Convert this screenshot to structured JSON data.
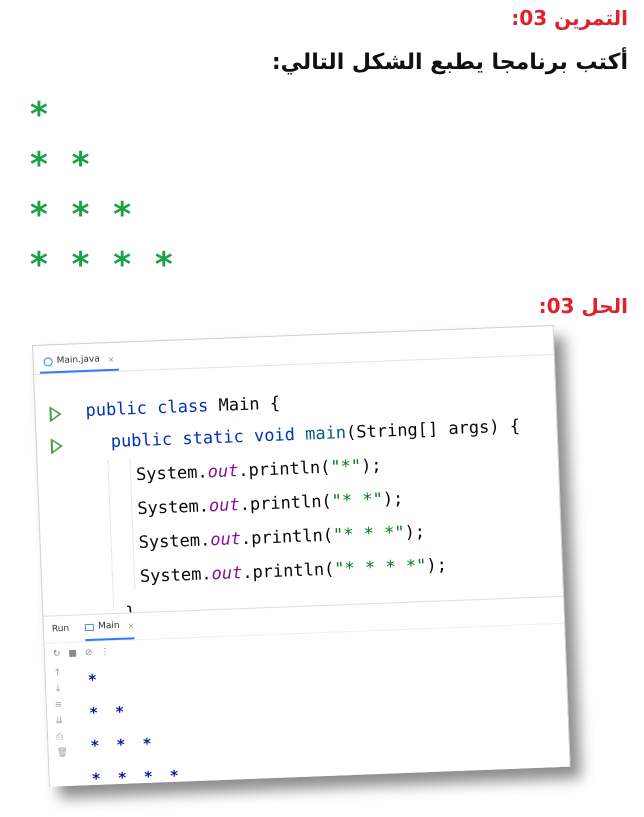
{
  "exercise": {
    "title": "التمرين 03:",
    "question": "أكتب برنامجا يطبع الشكل التالي:",
    "pattern": [
      "*",
      "* *",
      "* * *",
      "* * * *"
    ]
  },
  "solution": {
    "title": "الحل 03:"
  },
  "ide": {
    "editor_tab": {
      "label": "Main.java",
      "icon": "class-c-icon",
      "close": "×"
    },
    "code": {
      "class_line": {
        "kw1": "public",
        "kw2": "class",
        "name": "Main",
        "brace": "{"
      },
      "main_line": {
        "kw1": "public",
        "kw2": "static",
        "kw3": "void",
        "method": "main",
        "params": "(String[] args) {"
      },
      "print_lines": [
        {
          "prefix": "System.",
          "out": "out",
          "call": ".println(",
          "str": "\"*\"",
          "end": ");"
        },
        {
          "prefix": "System.",
          "out": "out",
          "call": ".println(",
          "str": "\"* *\"",
          "end": ");"
        },
        {
          "prefix": "System.",
          "out": "out",
          "call": ".println(",
          "str": "\"* * *\"",
          "end": ");"
        },
        {
          "prefix": "System.",
          "out": "out",
          "call": ".println(",
          "str": "\"* * * *\"",
          "end": ");"
        }
      ],
      "close_brace": "}"
    },
    "run_panel": {
      "label": "Run",
      "tab_label": "Main",
      "tab_close": "×",
      "console_output": [
        "*",
        "* *",
        "* * *",
        "* * * *"
      ]
    }
  },
  "colors": {
    "title_red": "#e0202a",
    "pattern_green": "#1aa046",
    "console_blue": "#0a1a9a"
  }
}
